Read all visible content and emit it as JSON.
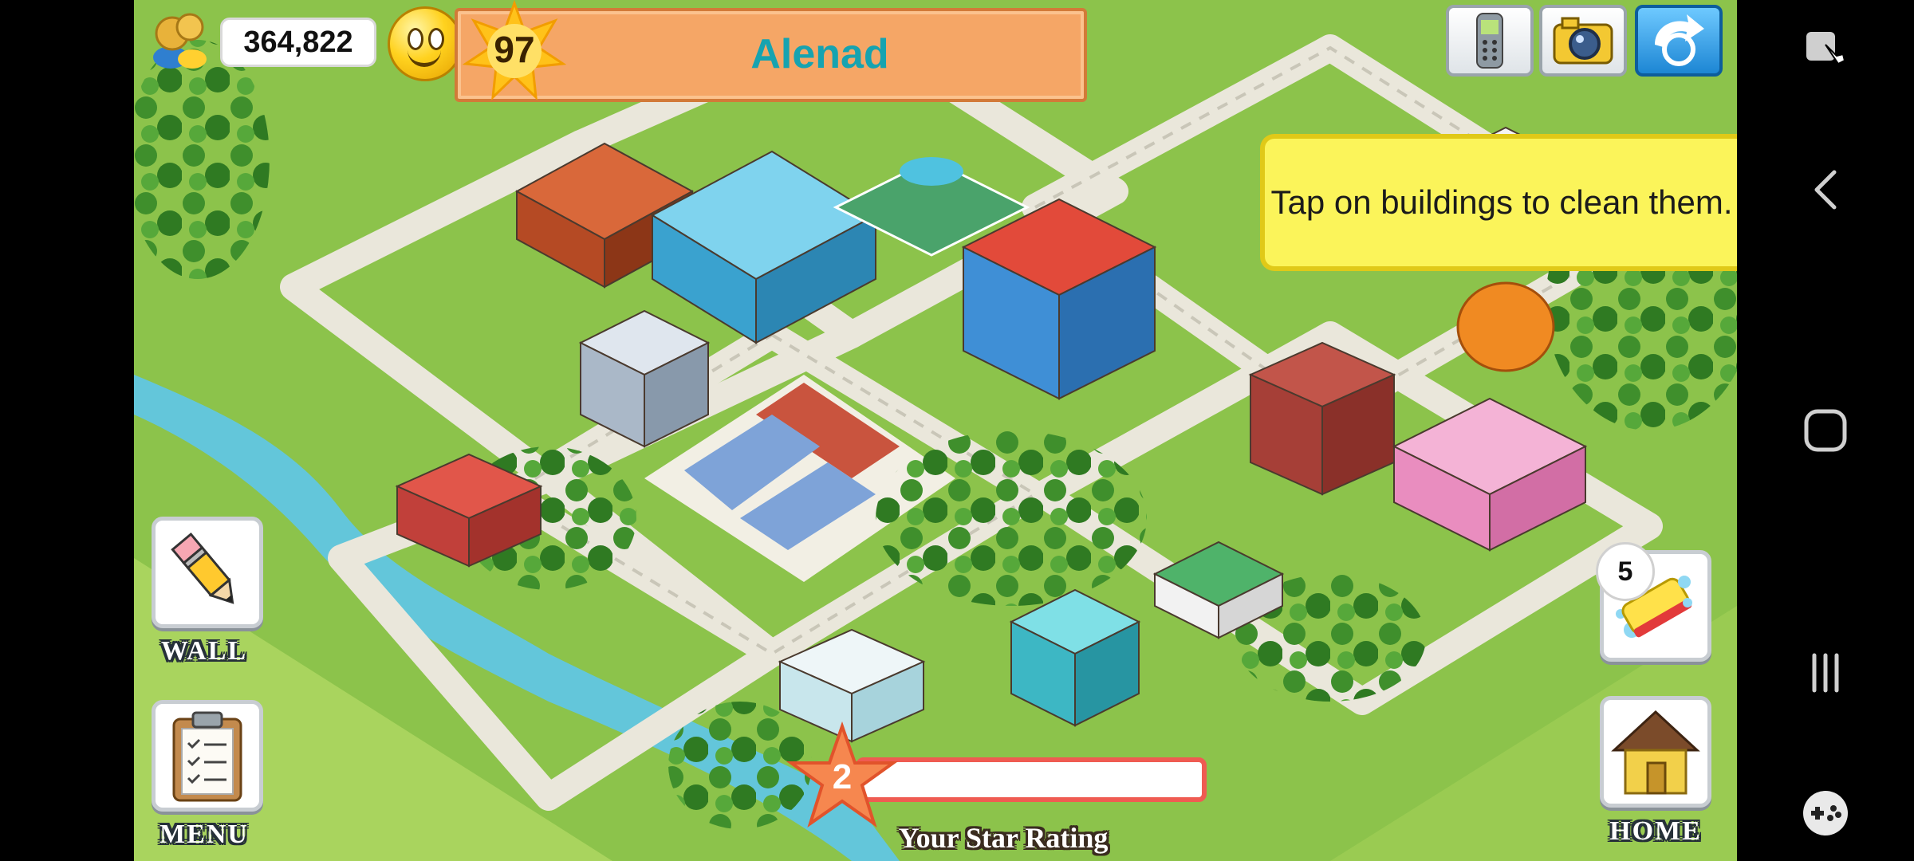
{
  "hud": {
    "coins": "364,822",
    "level": "97",
    "player_name": "Alenad"
  },
  "tip": {
    "text": "Tap on buildings to clean them."
  },
  "buttons": {
    "wall_label": "WALL",
    "menu_label": "MENU",
    "home_label": "HOME",
    "clean_count": "5"
  },
  "star_rating": {
    "value": "2",
    "label": "Your Star Rating",
    "progress": 0
  },
  "icons": {
    "coins": "coins-icon",
    "happiness": "happy-face-icon",
    "level": "level-star-icon",
    "phone": "phone-icon",
    "camera": "camera-icon",
    "share": "share-icon",
    "wall": "pencil-icon",
    "clean": "sponge-icon",
    "menu": "clipboard-icon",
    "home": "house-icon"
  },
  "colors": {
    "grass": "#8cc34b",
    "road": "#e8e6dc",
    "tip_bg": "#fbf45a",
    "level_panel": "#f5a666",
    "player_name": "#16a3b0",
    "rating_bar": "#ef5b52"
  }
}
